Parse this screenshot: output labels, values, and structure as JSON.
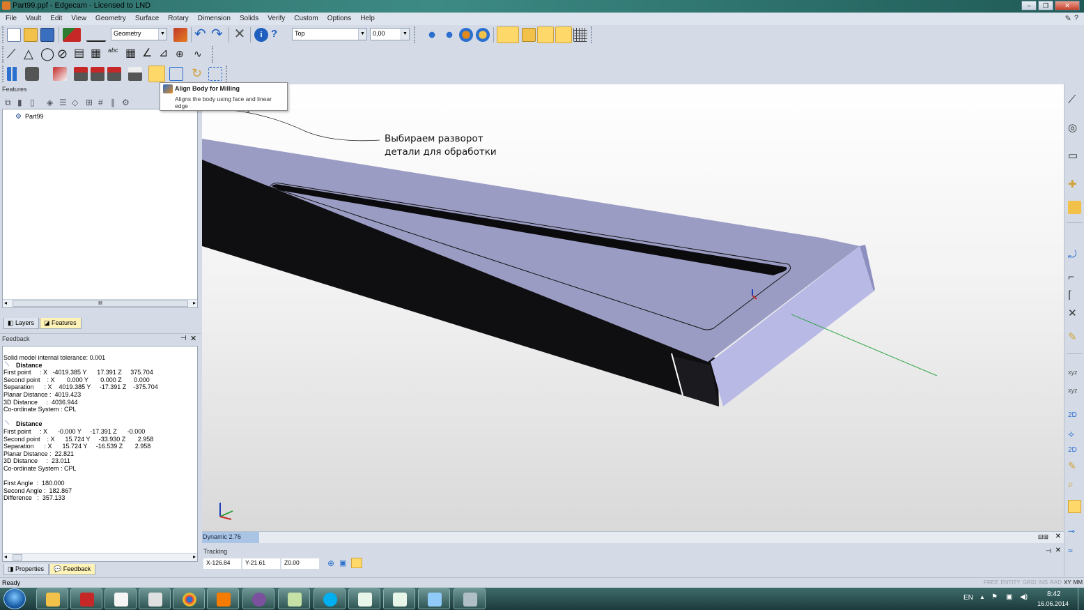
{
  "window": {
    "title": "Part99.ppf - Edgecam - Licensed to LND",
    "buttons": [
      "–",
      "❐",
      "✕"
    ]
  },
  "menu": [
    "File",
    "Vault",
    "Edit",
    "View",
    "Geometry",
    "Surface",
    "Rotary",
    "Dimension",
    "Solids",
    "Verify",
    "Custom",
    "Options",
    "Help"
  ],
  "toolbar": {
    "layer_combo": "Geometry",
    "view_combo": "Top",
    "depth_combo": "0,00"
  },
  "features_panel": {
    "header": "Features",
    "tree_root": "Part99",
    "tabs": [
      "Layers",
      "Features"
    ],
    "scroll_label": "III"
  },
  "feedback_panel": {
    "header": "Feedback",
    "lines": [
      {
        "t": "Solid model internal tolerance: 0.001"
      },
      {
        "h": "Distance"
      },
      {
        "t": "First point     : X   -4019.385 Y      17.391 Z     375.704"
      },
      {
        "t": "Second point    : X       0.000 Y       0.000 Z       0.000"
      },
      {
        "t": "Separation      : X    4019.385 Y     -17.391 Z    -375.704"
      },
      {
        "t": "Planar Distance :  4019.423"
      },
      {
        "t": "3D Distance     :  4036.944"
      },
      {
        "t": "Co-ordinate System : CPL"
      },
      {
        "gap": true
      },
      {
        "h": "Distance"
      },
      {
        "t": "First point     : X      -0.000 Y     -17.391 Z      -0.000"
      },
      {
        "t": "Second point    : X      15.724 Y     -33.930 Z       2.958"
      },
      {
        "t": "Separation      : X      15.724 Y     -16.539 Z       2.958"
      },
      {
        "t": "Planar Distance :  22.821"
      },
      {
        "t": "3D Distance     :  23.011"
      },
      {
        "t": "Co-ordinate System : CPL"
      },
      {
        "gap": true
      },
      {
        "t": "First Angle  :  180.000"
      },
      {
        "t": "Second Angle :  182.867"
      },
      {
        "t": "Difference   :  357.133"
      }
    ],
    "tabs": [
      "Properties",
      "Feedback"
    ]
  },
  "tooltip": {
    "title": "Align Body for Milling",
    "description": "Aligns the body using face and linear edge"
  },
  "annotation": {
    "line1": "Выбираем разворот",
    "line2": "детали для обработки"
  },
  "viewport": {
    "status": "Dynamic 2.76"
  },
  "tracking": {
    "header": "Tracking",
    "x": "X-126.84",
    "y": "Y-21.61",
    "z": "Z0.00"
  },
  "statusbar": {
    "text": "Ready",
    "flags": [
      "FREE",
      "ENTITY",
      "GRID",
      "INS",
      "RAD",
      "XY",
      "MM"
    ],
    "active_flags": [
      "XY",
      "MM"
    ]
  },
  "taskbar": {
    "language": "EN",
    "time": "8:42",
    "date": "16.06.2014"
  },
  "colors": {
    "body_top": "#9b9cc4",
    "body_side": "#0f0f12",
    "body_end": "#b9b9e6",
    "accent_selected": "#ffd86a"
  }
}
